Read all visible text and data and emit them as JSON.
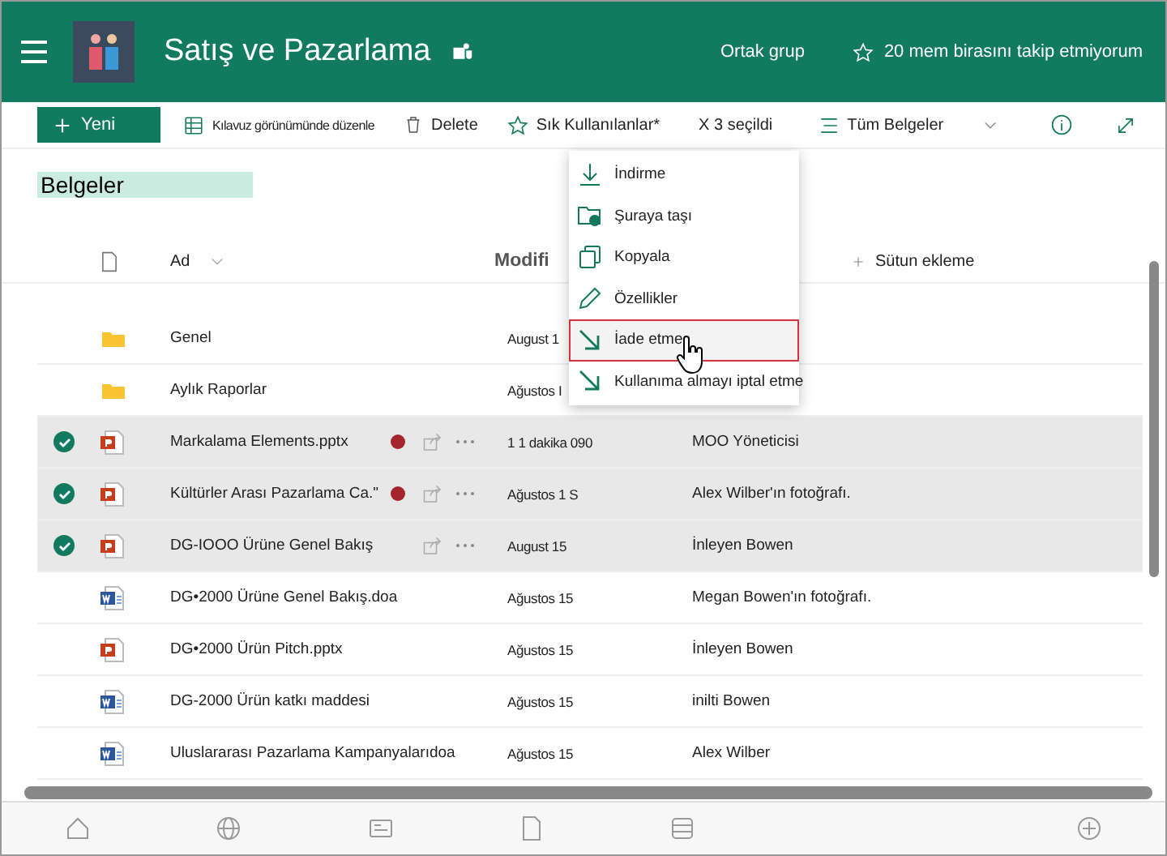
{
  "header": {
    "site_title": "Satış ve Pazarlama",
    "group_label": "Ortak grup",
    "follow_label": "20 mem birasını takip etmiyorum"
  },
  "toolbar": {
    "new_label": "Yeni",
    "grid_label": "Kılavuz görünümünde düzenle",
    "delete_label": "Delete",
    "favorites_label": "Sık Kullanılanlar*",
    "selection_count": "X 3 seçildi",
    "view_label": "Tüm Belgeler"
  },
  "library": {
    "title": "Belgeler"
  },
  "columns": [
    {
      "label": "Ad"
    },
    {
      "label": "Modifi"
    },
    {
      "label": "Sütun ekleme"
    }
  ],
  "rows": [
    {
      "kind": "folder",
      "name": "Genel",
      "modified": "August 1",
      "modified_by": "",
      "selected": false,
      "checked_out": false,
      "actions": false
    },
    {
      "kind": "folder",
      "name": "Aylık Raporlar",
      "modified": "Ağustos I",
      "modified_by": "",
      "selected": false,
      "checked_out": false,
      "actions": false
    },
    {
      "kind": "pptx",
      "name": "Markalama Elements.pptx",
      "modified": "1 1 dakika 090",
      "modified_by": "MOO Yöneticisi",
      "selected": true,
      "checked_out": true,
      "actions": true
    },
    {
      "kind": "pptx",
      "name": "Kültürler Arası Pazarlama Ca.\"",
      "modified": "Ağustos 1 S",
      "modified_by": "Alex Wilber'ın fotoğrafı.",
      "selected": true,
      "checked_out": true,
      "actions": true
    },
    {
      "kind": "pptx",
      "name": "DG-IOOO Ürüne Genel Bakış",
      "modified": "August 15",
      "modified_by": "İnleyen Bowen",
      "selected": true,
      "checked_out": false,
      "actions": true
    },
    {
      "kind": "docx",
      "name": "DG•2000 Ürüne Genel Bakış.doa",
      "modified": "Ağustos 15",
      "modified_by": "Megan Bowen'ın fotoğrafı.",
      "selected": false,
      "checked_out": false,
      "actions": false
    },
    {
      "kind": "pptx",
      "name": "DG•2000 Ürün Pitch.pptx",
      "modified": "Ağustos 15",
      "modified_by": "İnleyen Bowen",
      "selected": false,
      "checked_out": false,
      "actions": false
    },
    {
      "kind": "docx",
      "name": "DG-2000 Ürün katkı maddesi",
      "modified": "Ağustos 15",
      "modified_by": "inilti   Bowen",
      "selected": false,
      "checked_out": false,
      "actions": false
    },
    {
      "kind": "docx",
      "name": "Uluslararası Pazarlama Kampanyalarıdoa",
      "modified": "Ağustos 15",
      "modified_by": "Alex Wilber",
      "selected": false,
      "checked_out": false,
      "actions": false
    }
  ],
  "menu": [
    {
      "kind": "download",
      "label": "İndirme",
      "selected": false
    },
    {
      "kind": "move",
      "label": "Şuraya taşı",
      "selected": false
    },
    {
      "kind": "copy",
      "label": "Kopyala",
      "selected": false
    },
    {
      "kind": "edit",
      "label": "Özellikler",
      "selected": false
    },
    {
      "kind": "checkin",
      "label": "İade etme",
      "selected": true
    },
    {
      "kind": "checkin",
      "label": "Kullanıma almayı iptal etme",
      "selected": false
    }
  ]
}
